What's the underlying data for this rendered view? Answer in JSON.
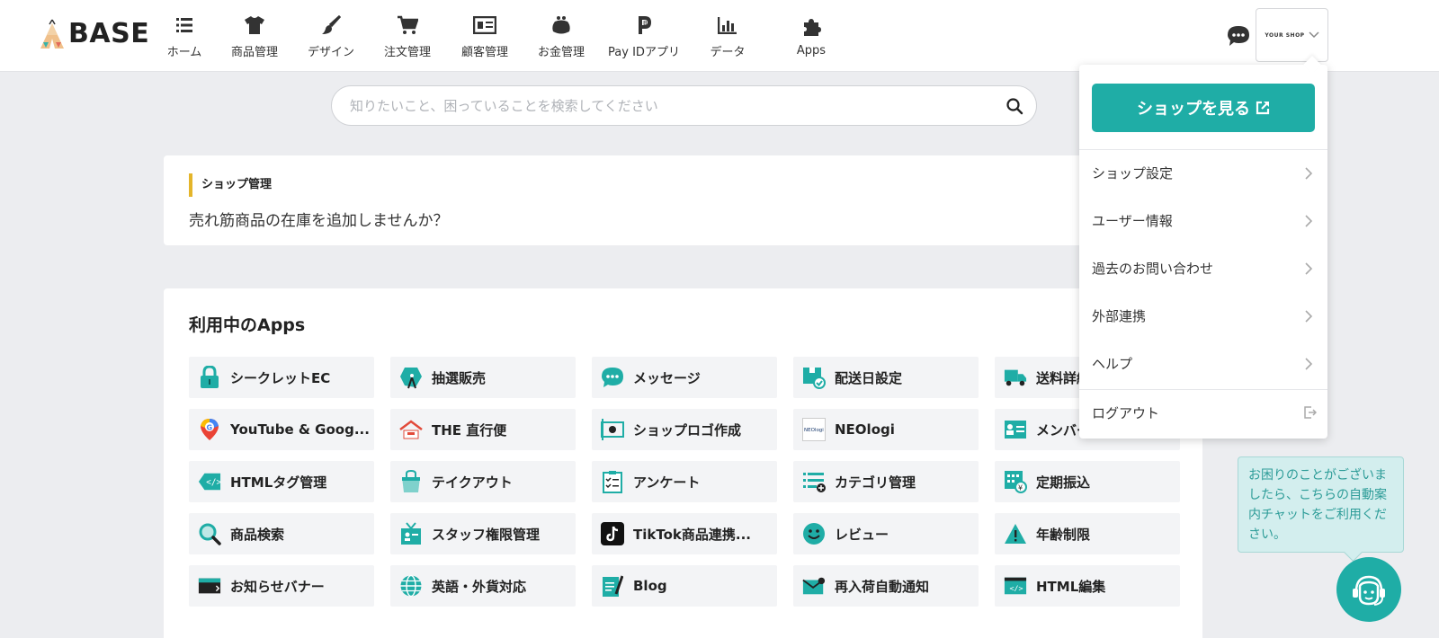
{
  "header": {
    "logo_text": "BASE",
    "nav": [
      {
        "label": "ホーム",
        "icon": "home-list-icon"
      },
      {
        "label": "商品管理",
        "icon": "tshirt-icon"
      },
      {
        "label": "デザイン",
        "icon": "brush-icon"
      },
      {
        "label": "注文管理",
        "icon": "cart-icon"
      },
      {
        "label": "顧客管理",
        "icon": "id-card-icon"
      },
      {
        "label": "お金管理",
        "icon": "purse-icon"
      },
      {
        "label": "Pay IDアプリ",
        "icon": "payid-icon"
      },
      {
        "label": "データ",
        "icon": "bar-chart-icon"
      },
      {
        "label": "Apps",
        "icon": "puzzle-icon"
      }
    ],
    "shop_button_label": "YOUR SHOP"
  },
  "search": {
    "placeholder": "知りたいこと、困っていることを検索してください"
  },
  "notice": {
    "label": "ショップ管理",
    "text": "売れ筋商品の在庫を追加しませんか？"
  },
  "apps": {
    "title": "利用中のApps",
    "items": [
      {
        "label": "シークレットEC",
        "icon": "lock-icon"
      },
      {
        "label": "抽選販売",
        "icon": "lottery-icon"
      },
      {
        "label": "メッセージ",
        "icon": "message-icon"
      },
      {
        "label": "配送日設定",
        "icon": "delivery-date-icon"
      },
      {
        "label": "送料詳細",
        "icon": "truck-icon"
      },
      {
        "label": "YouTube & Goog...",
        "icon": "google-icon"
      },
      {
        "label": "THE 直行便",
        "icon": "house-icon"
      },
      {
        "label": "ショップロゴ作成",
        "icon": "logo-frame-icon"
      },
      {
        "label": "NEOlogi",
        "icon": "neologi-icon"
      },
      {
        "label": "メンバーシップ",
        "icon": "member-card-icon"
      },
      {
        "label": "HTMLタグ管理",
        "icon": "html-tag-icon"
      },
      {
        "label": "テイクアウト",
        "icon": "takeout-bag-icon"
      },
      {
        "label": "アンケート",
        "icon": "clipboard-icon"
      },
      {
        "label": "カテゴリ管理",
        "icon": "category-list-icon"
      },
      {
        "label": "定期振込",
        "icon": "calendar-yen-icon"
      },
      {
        "label": "商品検索",
        "icon": "magnifier-icon"
      },
      {
        "label": "スタッフ権限管理",
        "icon": "staff-badge-icon"
      },
      {
        "label": "TikTok商品連携...",
        "icon": "tiktok-icon"
      },
      {
        "label": "レビュー",
        "icon": "smile-icon"
      },
      {
        "label": "年齢制限",
        "icon": "warning-icon"
      },
      {
        "label": "お知らせバナー",
        "icon": "banner-icon"
      },
      {
        "label": "英語・外貨対応",
        "icon": "globe-icon"
      },
      {
        "label": "Blog",
        "icon": "blog-icon"
      },
      {
        "label": "再入荷自動通知",
        "icon": "mail-icon"
      },
      {
        "label": "HTML編集",
        "icon": "html-window-icon"
      }
    ]
  },
  "dropdown": {
    "view_shop_label": "ショップを見る",
    "items": [
      {
        "label": "ショップ設定"
      },
      {
        "label": "ユーザー情報"
      },
      {
        "label": "過去のお問い合わせ"
      },
      {
        "label": "外部連携"
      },
      {
        "label": "ヘルプ"
      }
    ],
    "logout_label": "ログアウト"
  },
  "help": {
    "bubble_text": "お困りのことがございましたら、こちらの自動案内チャットをご利用ください。"
  },
  "colors": {
    "accent": "#1fada6",
    "notice_bar": "#e4b52a",
    "background": "#ecedf0"
  }
}
